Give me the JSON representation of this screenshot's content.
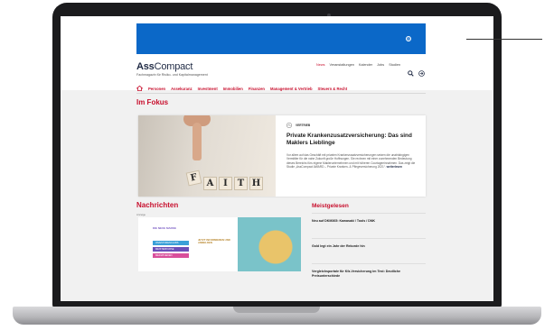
{
  "header": {
    "logo_bold": "Ass",
    "logo_light": "Compact",
    "tagline": "Fachmagazin für Risiko- und Kapitalmanagement",
    "top_links": [
      "News",
      "Veranstaltungen",
      "Kalender",
      "Jobs",
      "Studien"
    ]
  },
  "nav": {
    "items": [
      "Personen",
      "Assekuranz",
      "Investment",
      "Immobilien",
      "Finanzen",
      "Management & Vertrieb",
      "Steuern & Recht"
    ]
  },
  "fokus": {
    "heading": "Im Fokus",
    "category": "VERTRIEB",
    "title": "Private Krankenzusatzversicherung: Das sind Maklers Lieblinge",
    "excerpt": "Vor allem auf das Geschäft mit privaten Krankenzusatzversicherungen setzen die unabhängigen Vermittler für die nahe Zukunft große Hoffnungen. Sie rechnen mit einer zunehmenden Bedeutung dieses Bereichs fürs eigene Maklerunternehmen und mit höheren Courtageeinnahmen. Das zeigt die Studie „AssCompact AWARD – Private Kranken- & Pflegeversicherung 2021“.",
    "more_link": "weiterlesen",
    "blocks": [
      "F",
      "A",
      "I",
      "T",
      "H"
    ]
  },
  "news": {
    "heading": "Nachrichten",
    "ad_label": "Anzeige",
    "ad_logo": "DIE NEUE MARKE",
    "ad_tags": [
      "INVESTORENCLUBS",
      "MEISTERKURSE",
      "MEDIATHEKEN"
    ],
    "ad_text": "JETZT INFORMIEREN UND ANMELDEN"
  },
  "meistgelesen": {
    "heading": "Meistgelesen",
    "items": [
      "Neu auf DKM365: Kawasaki / Tools / DNK",
      "Gold legt ein Jahr der Rekorde hin",
      "Vergleichsportale für Kfz-Versicherung im Test: Deutliche Preisunterschiede"
    ]
  },
  "colors": {
    "brand_red": "#c8102e",
    "banner_blue": "#0b68c8",
    "logo_navy": "#1f2a44"
  }
}
